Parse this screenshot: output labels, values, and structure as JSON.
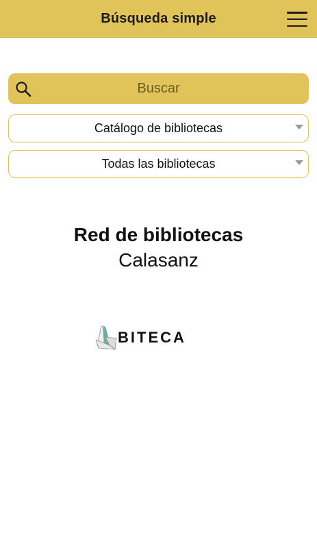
{
  "header": {
    "title": "Búsqueda simple",
    "menu_icon": "hamburger-menu-icon"
  },
  "search": {
    "placeholder": "Buscar",
    "icon": "search-icon"
  },
  "selects": {
    "catalog": "Catálogo de bibliotecas",
    "library": "Todas las bibliotecas"
  },
  "network": {
    "title": "Red de bibliotecas",
    "subtitle": "Calasanz"
  },
  "logo": {
    "text": "BITECA"
  },
  "colors": {
    "accent": "#e0c45a",
    "text": "#111111"
  }
}
